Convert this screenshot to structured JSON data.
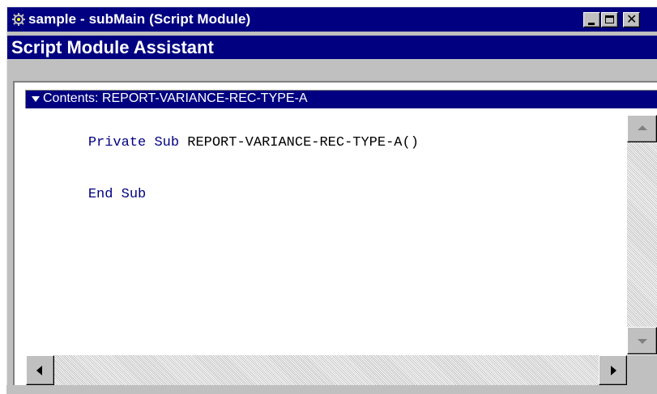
{
  "window": {
    "title": "sample - subMain (Script Module)",
    "icon": "script-module-icon",
    "minimize_icon": "minimize-icon",
    "maximize_icon": "maximize-icon",
    "close_glyph": "✕",
    "title_color": "#000080"
  },
  "assistant": {
    "header": "Script Module Assistant"
  },
  "contents": {
    "label": "Contents: REPORT-VARIANCE-REC-TYPE-A",
    "toggle_icon": "triangle-down-icon"
  },
  "code": {
    "line1": {
      "keyword1": "Private",
      "keyword2": "Sub",
      "name": "REPORT-VARIANCE-REC-TYPE-A()"
    },
    "line2": {
      "keyword1": "End",
      "keyword2": "Sub"
    },
    "keyword_color": "#000080"
  },
  "scrollbars": {
    "vertical_icons": [
      "arrow-up-icon",
      "arrow-down-icon"
    ],
    "horizontal_icons": [
      "arrow-left-icon",
      "arrow-right-icon"
    ]
  }
}
